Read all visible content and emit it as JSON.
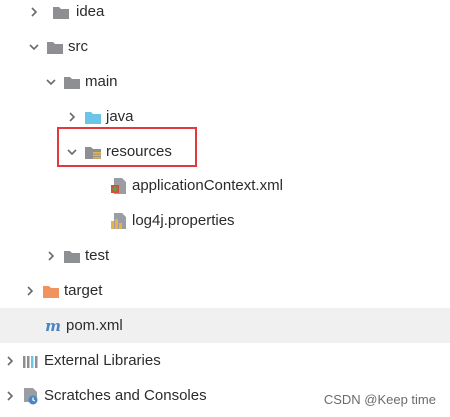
{
  "tree": {
    "idea": "idea",
    "src": "src",
    "main": "main",
    "java": "java",
    "resources": "resources",
    "app_context": "applicationContext.xml",
    "log4j": "log4j.properties",
    "test": "test",
    "target": "target",
    "pom": "pom.xml",
    "external_libraries": "External Libraries",
    "scratches": "Scratches and Consoles"
  },
  "watermark": "CSDN @Keep time",
  "colors": {
    "folder_gray": "#8d8f93",
    "folder_blue": "#6cc4e6",
    "folder_orange": "#f0935c",
    "highlight_border": "#e0393e",
    "selected_row": "#f0f0f0"
  }
}
